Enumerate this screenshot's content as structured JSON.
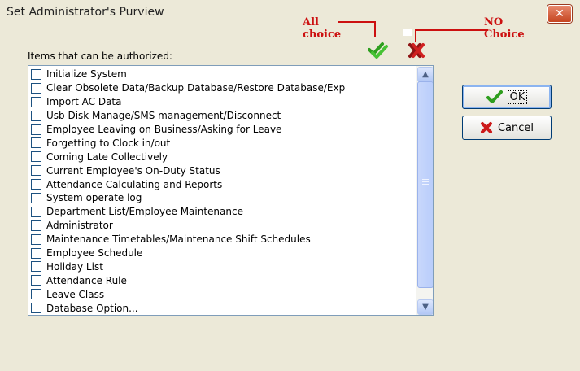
{
  "window": {
    "title": "Set Administrator's Purview",
    "close_glyph": "✕"
  },
  "annotations": {
    "all_choice": [
      "All",
      "choice"
    ],
    "no_choice": [
      "NO",
      "Choice"
    ]
  },
  "toolbar": {
    "select_all_icon": "double-check-icon",
    "clear_all_icon": "double-x-icon"
  },
  "list": {
    "label": "Items that can be authorized:",
    "items": [
      "Initialize System",
      "Clear Obsolete Data/Backup Database/Restore Database/Exp",
      "Import AC Data",
      "Usb Disk Manage/SMS management/Disconnect",
      "Employee Leaving on Business/Asking for Leave",
      "Forgetting to Clock in/out",
      "Coming Late Collectively",
      "Current Employee's On-Duty Status",
      "Attendance Calculating and Reports",
      "System operate log",
      "Department List/Employee Maintenance",
      "Administrator",
      "Maintenance Timetables/Maintenance Shift Schedules",
      "Employee Schedule",
      "Holiday List",
      "Attendance Rule",
      "Leave Class",
      "Database Option...",
      "..."
    ]
  },
  "buttons": {
    "ok": "OK",
    "cancel": "Cancel"
  },
  "colors": {
    "annotation": "#cc1010",
    "check_green": "#2e9e1e",
    "cross_red": "#cc1a1a"
  }
}
